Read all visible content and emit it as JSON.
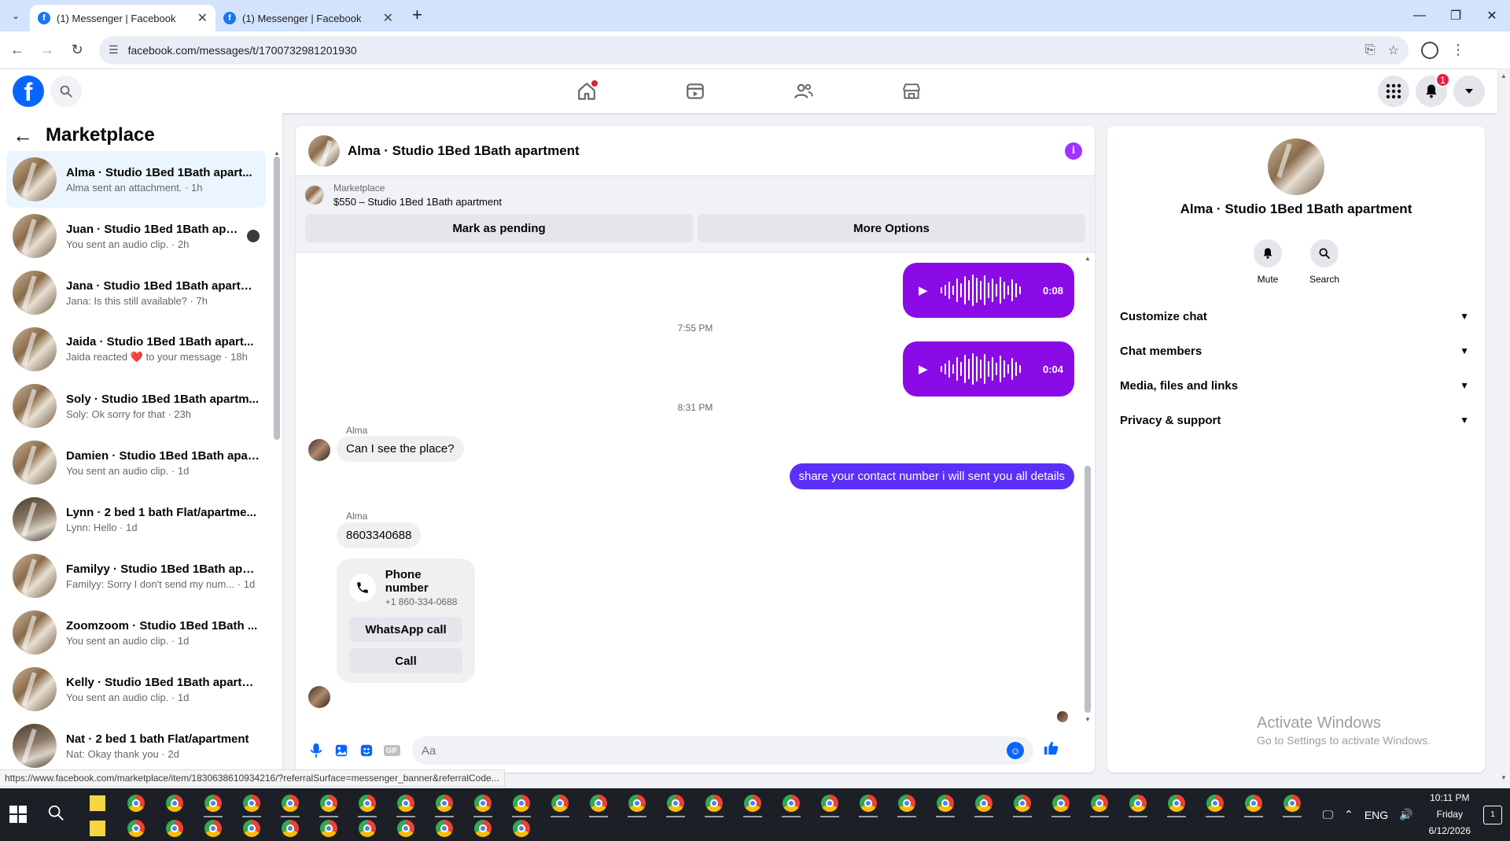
{
  "browser": {
    "tabs": [
      {
        "title": "(1) Messenger | Facebook",
        "active": true
      },
      {
        "title": "(1) Messenger | Facebook",
        "active": false
      }
    ],
    "url": "facebook.com/messages/t/1700732981201930",
    "status_url": "https://www.facebook.com/marketplace/item/1830638610934216/?referralSurface=messenger_banner&referralCode..."
  },
  "fb_header": {
    "logo": "f",
    "notification_count": "1"
  },
  "sidebar": {
    "title": "Marketplace",
    "conversations": [
      {
        "name": "Alma · Studio 1Bed 1Bath apart...",
        "snippet": "Alma sent an attachment. · 1h",
        "active": true
      },
      {
        "name": "Juan · Studio 1Bed 1Bath apart...",
        "snippet": "You sent an audio clip. · 2h"
      },
      {
        "name": "Jana · Studio 1Bed 1Bath apartm...",
        "snippet": "Jana: Is this still available? · 7h"
      },
      {
        "name": "Jaida · Studio 1Bed 1Bath apart...",
        "snippet": "Jaida reacted ❤️ to your message · 18h"
      },
      {
        "name": "Soly · Studio 1Bed 1Bath apartm...",
        "snippet": "Soly: Ok sorry for that · 23h"
      },
      {
        "name": "Damien · Studio 1Bed 1Bath apar...",
        "snippet": "You sent an audio clip. · 1d"
      },
      {
        "name": "Lynn · 2 bed 1 bath Flat/apartme...",
        "snippet": "Lynn: Hello · 1d"
      },
      {
        "name": "Familyy · Studio 1Bed 1Bath apar...",
        "snippet": "Familyy: Sorry I don't send my num... · 1d"
      },
      {
        "name": "Zoomzoom · Studio 1Bed 1Bath ...",
        "snippet": "You sent an audio clip. · 1d"
      },
      {
        "name": "Kelly · Studio 1Bed 1Bath apartm...",
        "snippet": "You sent an audio clip. · 1d"
      },
      {
        "name": "Nat · 2 bed 1 bath Flat/apartment",
        "snippet": "Nat: Okay thank you · 2d"
      }
    ]
  },
  "chat": {
    "title": "Alma · Studio 1Bed 1Bath apartment",
    "banner": {
      "label": "Marketplace",
      "listing": "$550 – Studio 1Bed 1Bath apartment",
      "btn_pending": "Mark as pending",
      "btn_more": "More Options"
    },
    "voice1_duration": "0:08",
    "timestamp1": "7:55 PM",
    "voice2_duration": "0:04",
    "timestamp2": "8:31 PM",
    "sender1": "Alma",
    "msg_in1": "Can I see the place?",
    "msg_out1": "share your contact number i will sent you all details",
    "sender2": "Alma",
    "msg_in2": "8603340688",
    "phone_card": {
      "title": "Phone number",
      "number": "+1 860-334-0688",
      "btn_whatsapp": "WhatsApp call",
      "btn_call": "Call"
    },
    "composer_placeholder": "Aa"
  },
  "right_panel": {
    "name": "Alma · Studio 1Bed 1Bath apartment",
    "actions": [
      {
        "label": "Mute",
        "icon": "bell-icon"
      },
      {
        "label": "Search",
        "icon": "search-icon"
      }
    ],
    "sections": [
      "Customize chat",
      "Chat members",
      "Media, files and links",
      "Privacy & support"
    ]
  },
  "watermark": {
    "line1": "Activate Windows",
    "line2": "Go to Settings to activate Windows."
  },
  "taskbar": {
    "time": "10:11 PM",
    "day": "Friday",
    "date": "6/12/2026",
    "lang": "ENG",
    "notif_count": "1"
  },
  "colors": {
    "accent": "#0866ff",
    "voice_bubble": "#8a0be6",
    "out_bubble": "#5b2ff7",
    "badge": "#e41e3f"
  }
}
